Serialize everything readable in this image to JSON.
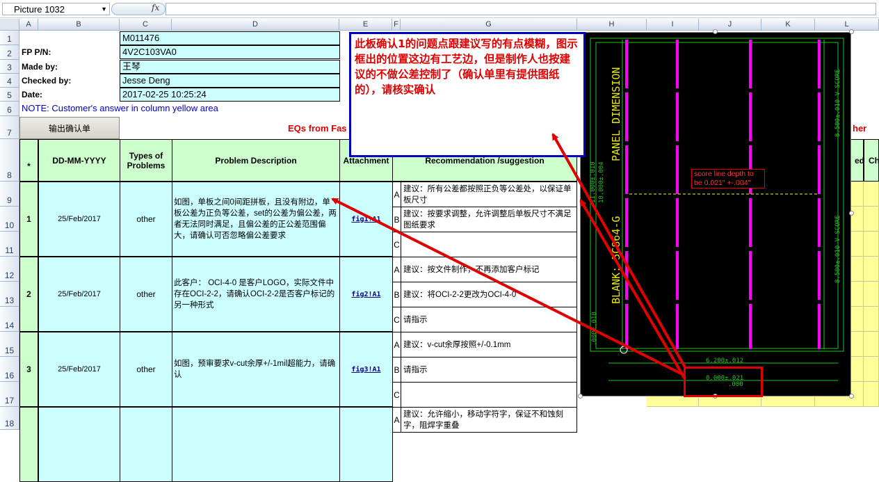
{
  "formula_bar": {
    "name_box": "Picture 1032",
    "fx_label": "fx",
    "formula": ""
  },
  "columns": [
    "A",
    "B",
    "C",
    "D",
    "E",
    "F",
    "G",
    "H",
    "I",
    "J",
    "K",
    "L"
  ],
  "rows": [
    "1",
    "2",
    "3",
    "4",
    "5",
    "6",
    "7",
    "8",
    "9",
    "10",
    "11",
    "12",
    "13",
    "14",
    "15",
    "16",
    "17",
    "18"
  ],
  "info": {
    "fp_label": "FP P/N:",
    "made_label": "Made by:",
    "checked_label": "Checked by:",
    "date_label": "Date:",
    "c1": "M011476",
    "fp_value": "4V2C103VA0",
    "made_value": "王琴",
    "checked_value": "Jesse Deng",
    "date_value": "2017-02-25 10:25:24"
  },
  "note": "NOTE: Customer's  answer in column yellow area",
  "export_button": "输出确认单",
  "eq_title_left": "EQs from Fas",
  "eq_title_right": "her",
  "headers": {
    "star": "*",
    "date": "DD-MM-YYYY",
    "types": "Types of Problems",
    "problem": "Problem Description",
    "attachment": "Attachment",
    "recommendation": "Recommendation /suggestion",
    "k_partial": "ed",
    "l_partial": "Ch"
  },
  "problems": [
    {
      "idx": "1",
      "date": "25/Feb/2017",
      "type": "other",
      "desc": "如图，单板之间0间距拼板，且没有附边，单板公差为正负等公差，set的公差为偏公差，两者无法同时满足，且偏公差的正公差范围偏大，请确认可否忽略偏公差要求",
      "link": "fig1!A1",
      "options": [
        {
          "letter": "A",
          "text": "建议：所有公差都按照正负等公差处，以保证单板尺寸"
        },
        {
          "letter": "B",
          "text": "建议：按要求调整，允许调整后单板尺寸不满足图纸要求"
        },
        {
          "letter": "C",
          "text": ""
        }
      ]
    },
    {
      "idx": "2",
      "date": "25/Feb/2017",
      "type": "other",
      "desc": "此客户： OCI-4-0 是客户LOGO，实际文件中存在OCI-2-2，请确认OCI-2-2是否客户标记的另一种形式",
      "link": "fig2!A1",
      "options": [
        {
          "letter": "A",
          "text": "建议：按文件制作，不再添加客户标记"
        },
        {
          "letter": "B",
          "text": "建议：将OCI-2-2更改为OCI-4-0"
        },
        {
          "letter": "C",
          "text": "请指示"
        }
      ]
    },
    {
      "idx": "3",
      "date": "25/Feb/2017",
      "type": "other",
      "desc": "如图，预审要求v-cut余厚+/-1mil超能力，请确认",
      "link": "fig3!A1",
      "options": [
        {
          "letter": "A",
          "text": "建议：v-cut余厚按照+/-0.1mm"
        },
        {
          "letter": "B",
          "text": "请指示"
        },
        {
          "letter": "C",
          "text": ""
        }
      ]
    },
    {
      "idx": "",
      "date": "",
      "type": "",
      "desc": "",
      "link": "",
      "options": [
        {
          "letter": "A",
          "text": "建议：允许缩小，移动字符字，保证不和蚀刻字，阻焊字重叠"
        }
      ]
    }
  ],
  "comment": "此板确认1的问题点跟建议写的有点模糊，图示框出的位置这边有工艺边，但是制作人也按建议的不做公差控制了（确认单里有提供图纸的），请核实确认",
  "drawing": {
    "panel_dimension": "PANEL DIMENSION",
    "blank": "BLANK: 5C864-G",
    "score_note_line1": "score line depth to",
    "score_note_line2": "be 0.021\" +-.004\"",
    "vscore_top": "8.500±.010 V-SCORE",
    "vscore_bottom": "8.500±.010 V-SCORE",
    "dim_left_1": "11.000±.010",
    "dim_left_2": "10.000±.004",
    "dim_left_3": ".000±.010",
    "dim_bottom_1": "6.200±.012",
    "dim_bottom_2": "0.000±.021",
    "dim_bottom_3": ".000"
  },
  "colors": {
    "cyan": "#ccffff",
    "green": "#ccffcc",
    "yellow": "#ffff99",
    "red": "#e00000",
    "magenta": "#ff00ff"
  }
}
